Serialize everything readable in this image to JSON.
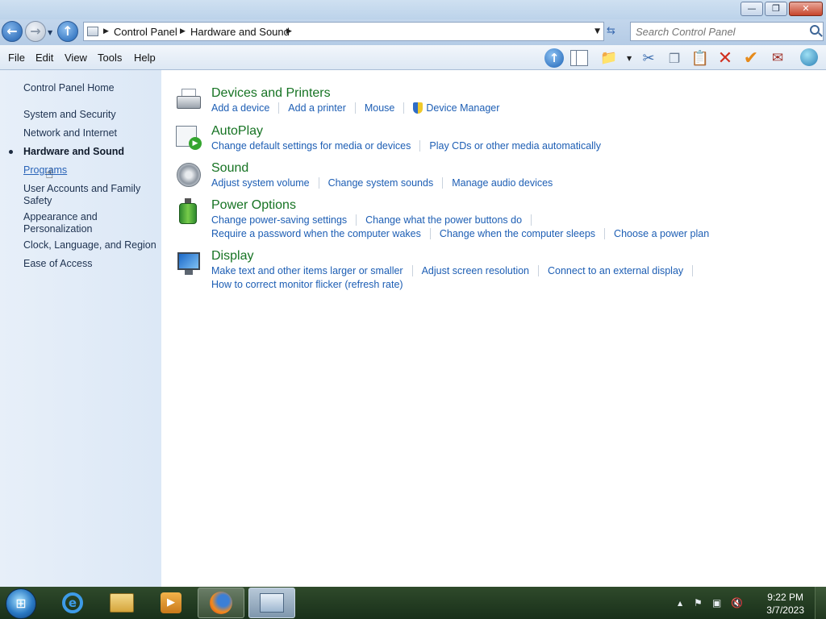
{
  "window": {
    "minimize_glyph": "—",
    "restore_glyph": "❐",
    "close_glyph": "✕"
  },
  "address": {
    "crumbs": [
      "Control Panel",
      "Hardware and Sound"
    ],
    "search_placeholder": "Search Control Panel"
  },
  "menu": {
    "items": [
      "File",
      "Edit",
      "View",
      "Tools",
      "Help"
    ]
  },
  "sidebar": {
    "home": "Control Panel Home",
    "items": [
      "System and Security",
      "Network and Internet",
      "Hardware and Sound",
      "Programs",
      "User Accounts and Family",
      "Safety",
      "Appearance and",
      "Personalization",
      "Clock, Language, and Region",
      "Ease of Access"
    ],
    "current": "Hardware and Sound"
  },
  "categories": [
    {
      "title": "Devices and Printers",
      "links": [
        "Add a device",
        "Add a printer",
        "Mouse",
        "Device Manager"
      ]
    },
    {
      "title": "AutoPlay",
      "links": [
        "Change default settings for media or devices",
        "Play CDs or other media automatically"
      ]
    },
    {
      "title": "Sound",
      "links": [
        "Adjust system volume",
        "Change system sounds",
        "Manage audio devices"
      ]
    },
    {
      "title": "Power Options",
      "links_row1": [
        "Change power-saving settings",
        "Change what the power buttons do"
      ],
      "links_row2": [
        "Require a password when the computer wakes",
        "Change when the computer sleeps",
        "Choose a power plan"
      ]
    },
    {
      "title": "Display",
      "links_row1": [
        "Make text and other items larger or smaller",
        "Adjust screen resolution",
        "Connect to an external display"
      ],
      "links_row2": [
        "How to correct monitor flicker (refresh rate)"
      ]
    }
  ],
  "taskbar": {
    "clock_time": "9:22 PM",
    "clock_date": "3/7/2023",
    "tray_arrow": "▲"
  }
}
